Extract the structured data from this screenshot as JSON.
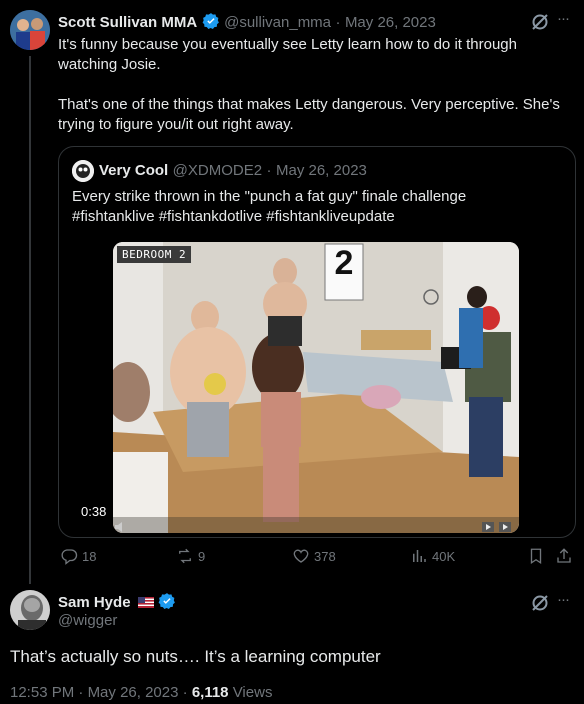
{
  "tweet1": {
    "author_name": "Scott Sullivan MMA",
    "handle": "@sullivan_mma",
    "date": "May 26, 2023",
    "text_line1": "It's funny because you eventually see Letty learn how to do it through",
    "text_line2": "watching Josie.",
    "text_line3": "That's one of the things that makes Letty dangerous. Very perceptive. She's",
    "text_line4": "trying to figure you/it out right away."
  },
  "quote": {
    "author_name": "Very Cool",
    "handle": "@XDMODE2",
    "date": "May 26, 2023",
    "text_line1": "Every strike thrown in the \"punch a fat guy\" finale challenge",
    "text_line2": "#fishtanklive #fishtankdotlive #fishtankliveupdate",
    "video": {
      "room_label": "BEDROOM 2",
      "sign_number": "2",
      "duration": "0:38"
    }
  },
  "actions": {
    "replies": "18",
    "retweets": "9",
    "likes": "378",
    "views": "40K"
  },
  "tweet2": {
    "author_name": "Sam Hyde",
    "handle": "@wigger",
    "text": "That’s actually so nuts…. It’s a learning computer",
    "time": "12:53 PM",
    "date": "May 26, 2023",
    "views_count": "6,118",
    "views_label": "Views"
  },
  "separator": "·",
  "menu_glyph": "···",
  "colors": {
    "background": "#000000",
    "text": "#e7e9ea",
    "muted": "#71767b",
    "verified": "#1d9bf0",
    "border": "#2f3336"
  }
}
